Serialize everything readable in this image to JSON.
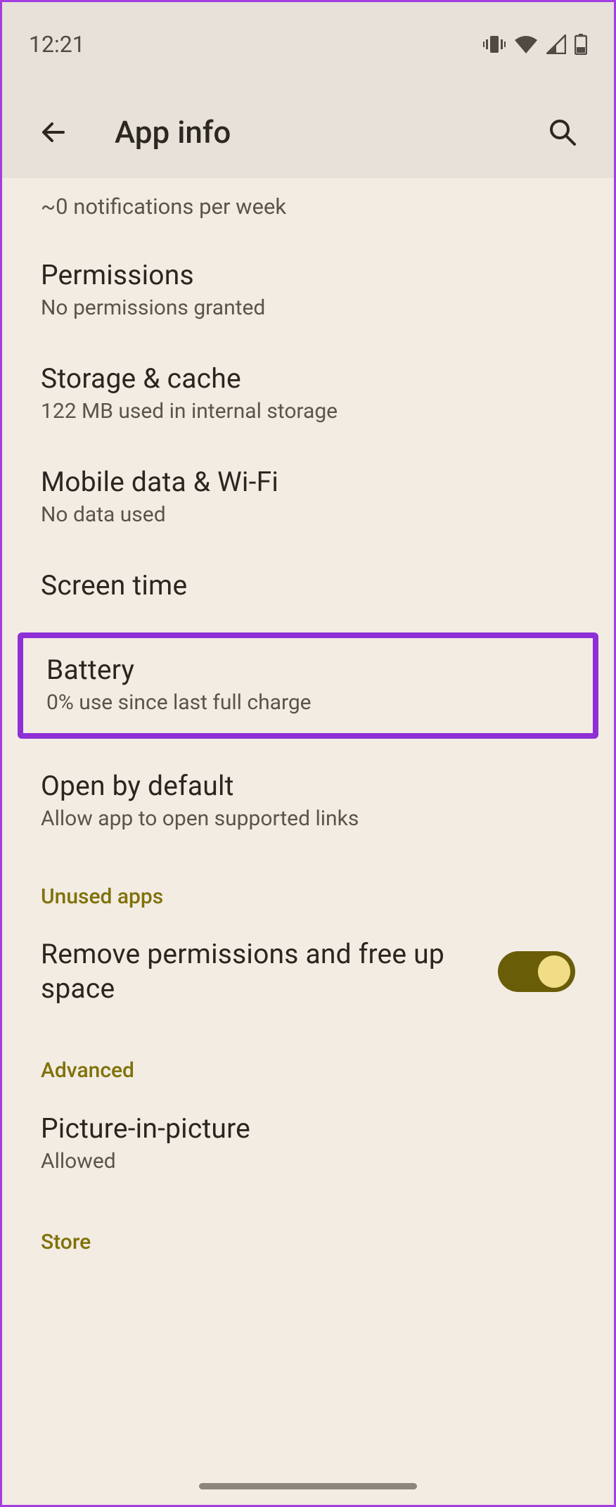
{
  "status": {
    "time": "12:21"
  },
  "header": {
    "title": "App info"
  },
  "notifications_line": "~0 notifications per week",
  "items": {
    "permissions": {
      "title": "Permissions",
      "sub": "No permissions granted"
    },
    "storage": {
      "title": "Storage & cache",
      "sub": "122 MB used in internal storage"
    },
    "mobile": {
      "title": "Mobile data & Wi-Fi",
      "sub": "No data used"
    },
    "screentime": {
      "title": "Screen time"
    },
    "battery": {
      "title": "Battery",
      "sub": "0% use since last full charge"
    },
    "openby": {
      "title": "Open by default",
      "sub": "Allow app to open supported links"
    },
    "remove_perm": {
      "title": "Remove permissions and free up space"
    },
    "pip": {
      "title": "Picture-in-picture",
      "sub": "Allowed"
    }
  },
  "sections": {
    "unused": "Unused apps",
    "advanced": "Advanced",
    "store": "Store"
  }
}
